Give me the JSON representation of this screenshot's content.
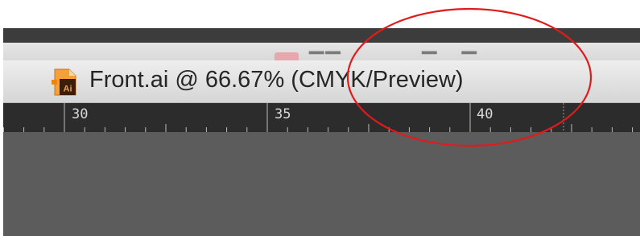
{
  "document_tab": {
    "title": "Front.ai @ 66.67% (CMYK/Preview)",
    "icon": "adobe-illustrator-file-icon",
    "icon_text": "Ai"
  },
  "ruler": {
    "labels": [
      "30",
      "35",
      "40"
    ]
  },
  "colors": {
    "annotation": "#e01b1b",
    "ruler_bg": "#2c2c2c",
    "canvas_bg": "#5c5c5c",
    "icon_orange": "#e8861a"
  }
}
